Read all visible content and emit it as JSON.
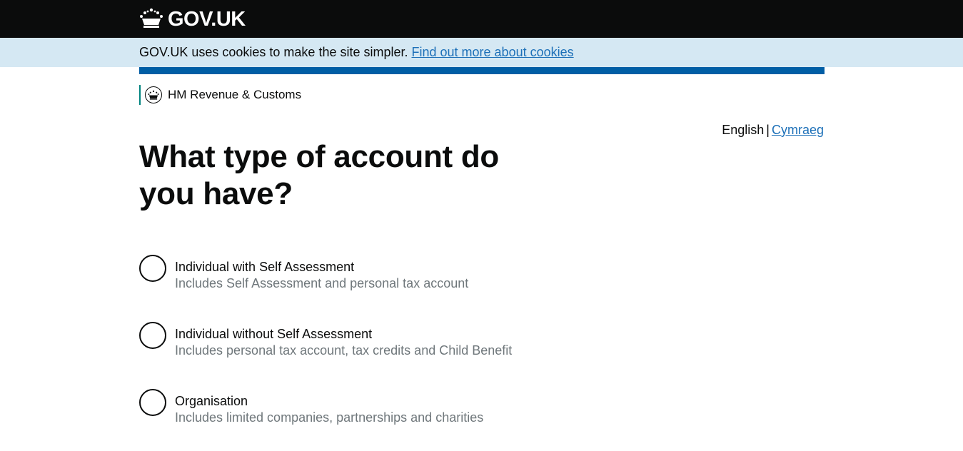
{
  "header": {
    "logo_text": "GOV.UK",
    "logo_icon": "crown-icon"
  },
  "cookie_banner": {
    "text": "GOV.UK uses cookies to make the site simpler.",
    "link_text": "Find out more about cookies"
  },
  "organisation": {
    "name": "HM Revenue & Customs",
    "crest_icon": "crest-icon"
  },
  "language": {
    "current": "English",
    "separator": "|",
    "other": "Cymraeg"
  },
  "page": {
    "title": "What type of account do you have?"
  },
  "options": [
    {
      "label": "Individual with Self Assessment",
      "hint": "Includes Self Assessment and personal tax account"
    },
    {
      "label": "Individual without Self Assessment",
      "hint": "Includes personal tax account, tax credits and Child Benefit"
    },
    {
      "label": "Organisation",
      "hint": "Includes limited companies, partnerships and charities"
    }
  ],
  "colors": {
    "header_bg": "#0b0c0c",
    "cookie_bg": "#d5e8f3",
    "link": "#1d70b8",
    "brand_bar": "#005ea5",
    "hmrc_line": "#00847f",
    "hint_text": "#6f777b"
  }
}
